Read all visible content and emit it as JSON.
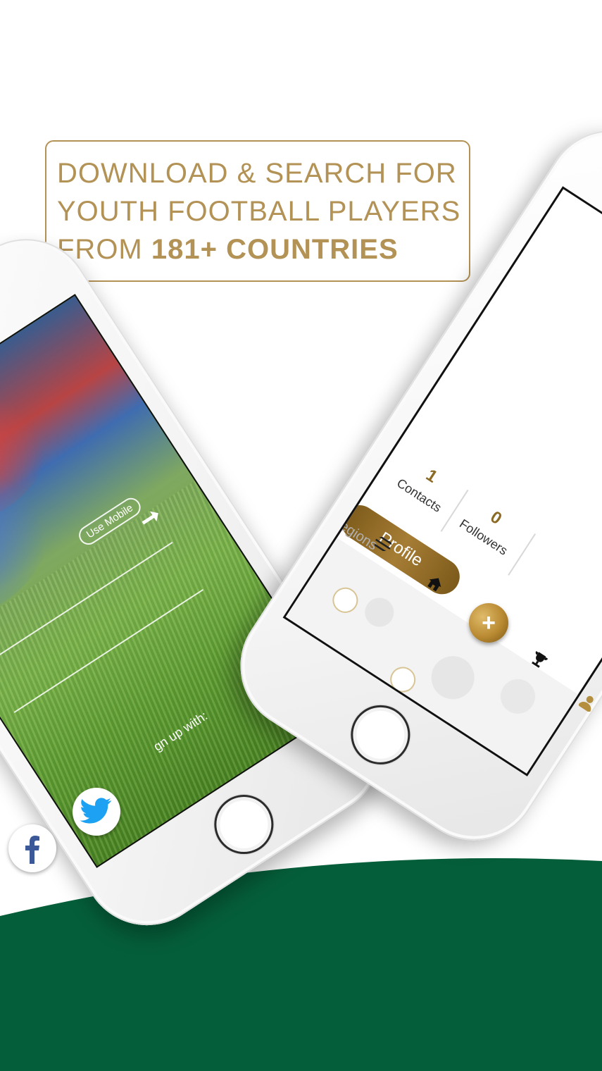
{
  "headline": {
    "line1": "DOWNLOAD & SEARCH FOR",
    "line2": "YOUTH FOOTBALL PLAYERS",
    "line3_prefix": "FROM ",
    "line3_emphasis": "181+ COUNTRIES"
  },
  "left_phone": {
    "use_mobile_label": "Use Mobile",
    "signup_label": "gn up with:",
    "social_buttons": [
      "facebook-icon",
      "twitter-icon"
    ]
  },
  "right_phone": {
    "stats": [
      {
        "value": "1",
        "label": "Contacts"
      },
      {
        "value": "0",
        "label": "Followers"
      }
    ],
    "profile_button_label": "Profile",
    "regions_label": "Regions",
    "nav_icons": [
      "menu-icon",
      "home-icon",
      "add-icon",
      "trophy-icon",
      "user-icon"
    ],
    "fab_label": "+"
  },
  "colors": {
    "gold": "#b39256",
    "dark_gold": "#8a6a24",
    "green_band": "#055e3a",
    "white": "#ffffff"
  }
}
